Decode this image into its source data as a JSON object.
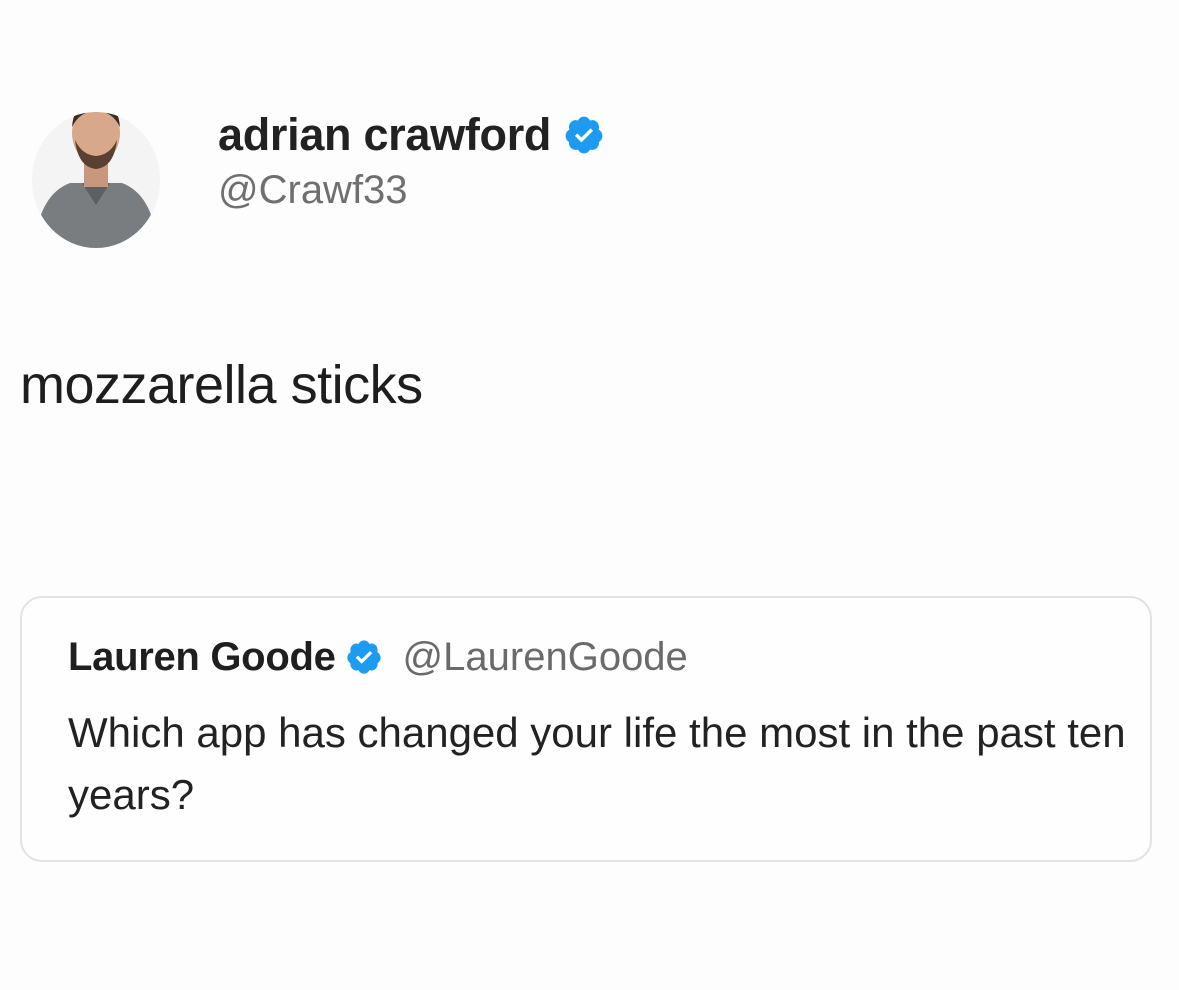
{
  "tweet": {
    "author": {
      "display_name": "adrian crawford",
      "handle": "@Crawf33",
      "verified_icon": "verified-badge-icon"
    },
    "text": "mozzarella sticks",
    "quoted_tweet": {
      "author": {
        "display_name": "Lauren Goode",
        "handle": "@LaurenGoode",
        "verified_icon": "verified-badge-icon"
      },
      "text": "Which app has changed your life the most in the past ten years?"
    }
  },
  "colors": {
    "verified_blue": "#1d9bf0",
    "handle_gray": "#6f6f6f",
    "card_border": "#e2e2e2"
  }
}
